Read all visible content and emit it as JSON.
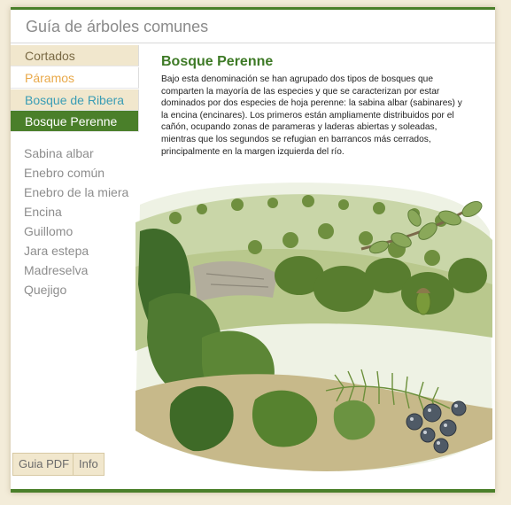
{
  "app": {
    "title": "Guía de árboles comunes"
  },
  "tabs": [
    {
      "label": "Cortados"
    },
    {
      "label": "Páramos"
    },
    {
      "label": "Bosque de Ribera"
    },
    {
      "label": "Bosque Perenne"
    }
  ],
  "species": [
    {
      "label": "Sabina albar"
    },
    {
      "label": "Enebro común"
    },
    {
      "label": "Enebro de la miera"
    },
    {
      "label": "Encina"
    },
    {
      "label": "Guillomo"
    },
    {
      "label": "Jara estepa"
    },
    {
      "label": "Madreselva"
    },
    {
      "label": "Quejigo"
    }
  ],
  "footer": {
    "pdf_label": "Guia PDF",
    "info_label": "Info"
  },
  "content": {
    "title": "Bosque Perenne",
    "description": "Bajo esta denominación se han agrupado dos tipos de bosques que comparten la mayoría de las especies y que se caracterizan por estar dominados por dos especies de hoja perenne: la sabina albar (sabinares) y la encina (encinares). Los primeros están ampliamente distribuidos por el cañón, ocupando zonas de parameras y laderas abiertas y soleadas, mientras que los segundos se refugian en barrancos más cerrados, principalmente en la margen izquierda del río."
  },
  "colors": {
    "accent": "#4a7f2a",
    "tab_bg": "#f1e7cd",
    "paramos_text": "#e9a94a",
    "ribera_text": "#3a9db5",
    "page_bg": "#f3ecd9"
  }
}
